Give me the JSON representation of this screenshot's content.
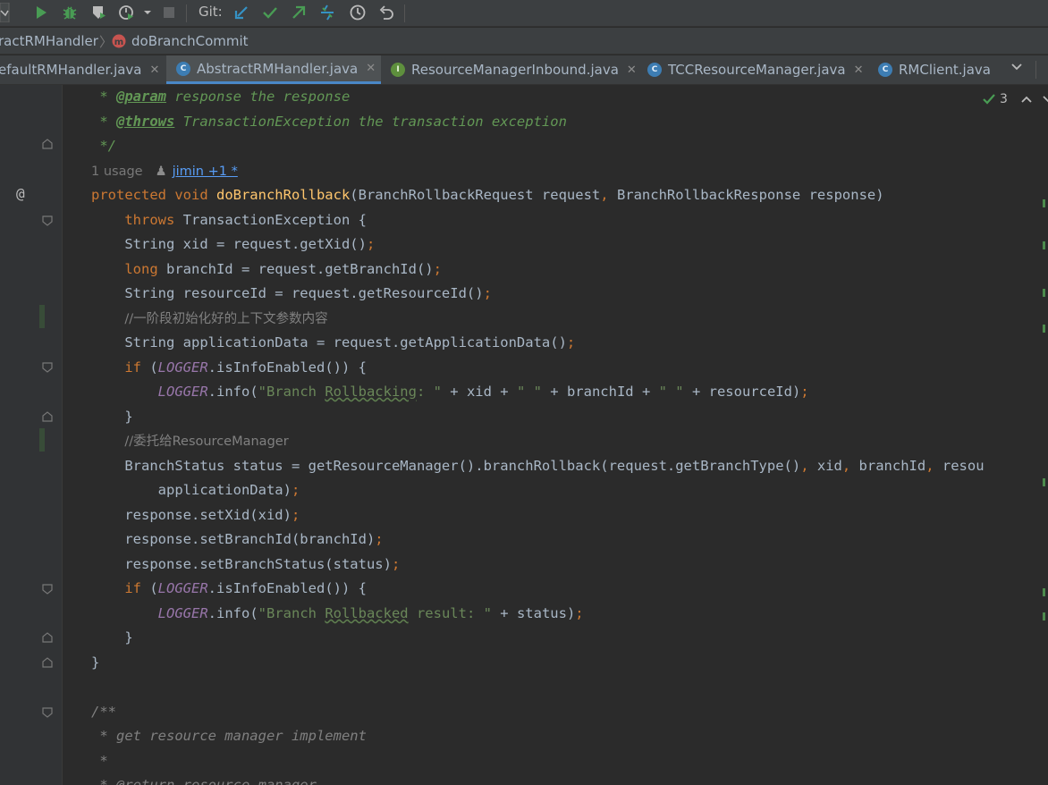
{
  "toolbar": {
    "git_label": "Git:"
  },
  "breadcrumb": {
    "class_name": "ractRMHandler",
    "method_name": "doBranchCommit"
  },
  "tabs": [
    {
      "label": "efaultRMHandler.java",
      "icon": "",
      "active": false
    },
    {
      "label": "AbstractRMHandler.java",
      "icon": "C",
      "active": true
    },
    {
      "label": "ResourceManagerInbound.java",
      "icon": "I",
      "active": false
    },
    {
      "label": "TCCResourceManager.java",
      "icon": "C",
      "active": false
    },
    {
      "label": "RMClient.java",
      "icon": "C",
      "active": false
    }
  ],
  "inspections": {
    "count": "3"
  },
  "hint": {
    "usages": "1 usage",
    "author": "jimin +1 *"
  },
  "code": {
    "doc_param_tag": "@param",
    "doc_param_text": " response the response",
    "doc_throws_tag": "@throws",
    "doc_throws_text": " TransactionException the transaction exception",
    "doc_end": "*/",
    "sig_kw": "protected void ",
    "sig_name": "doBranchRollback",
    "sig_rest": "(BranchRollbackRequest request",
    "sig_rest2": " BranchRollbackResponse response)",
    "throws_kw": "throws",
    "throws_rest": " TransactionException {",
    "l_xid": "String xid = request.getXid()",
    "l_branch_kw": "long",
    "l_branch": " branchId = request.getBranchId()",
    "l_resource": "String resourceId = request.getResourceId()",
    "c_phase": "//一阶段初始化好的上下文参数内容",
    "l_appdata": "String applicationData = request.getApplicationData()",
    "if_kw": "if",
    "logger": "LOGGER",
    "if_rest": ".isInfoEnabled()) {",
    "info_call": ".info(",
    "str_rb1": "\"Branch ",
    "str_rb_word": "Rollbacking",
    "str_rb2": ": \"",
    "log1_rest1": " + xid + ",
    "str_space": "\" \"",
    "log1_rest2": " + branchId + ",
    "log1_rest3": " + resourceId)",
    "close_brace": "}",
    "c_delegate": "//委托给ResourceManager",
    "l_status1": "BranchStatus status = getResourceManager().branchRollback(request.getBranchType()",
    "l_status1b": " xid",
    "l_status1c": " branchId",
    "l_status1d": " resou",
    "l_status2": "applicationData)",
    "l_setxid": "response.setXid(xid)",
    "l_setbranch": "response.setBranchId(branchId)",
    "l_setstatus": "response.setBranchStatus(status)",
    "str_rbd1": "\"Branch ",
    "str_rbd_word": "Rollbacked",
    "str_rbd2": " result: \"",
    "log2_rest": " + status)",
    "doc2_start": "/**",
    "doc2_line1": " * get resource manager implement",
    "doc2_line2": " *",
    "doc2_line3": " * @return resource manager"
  }
}
